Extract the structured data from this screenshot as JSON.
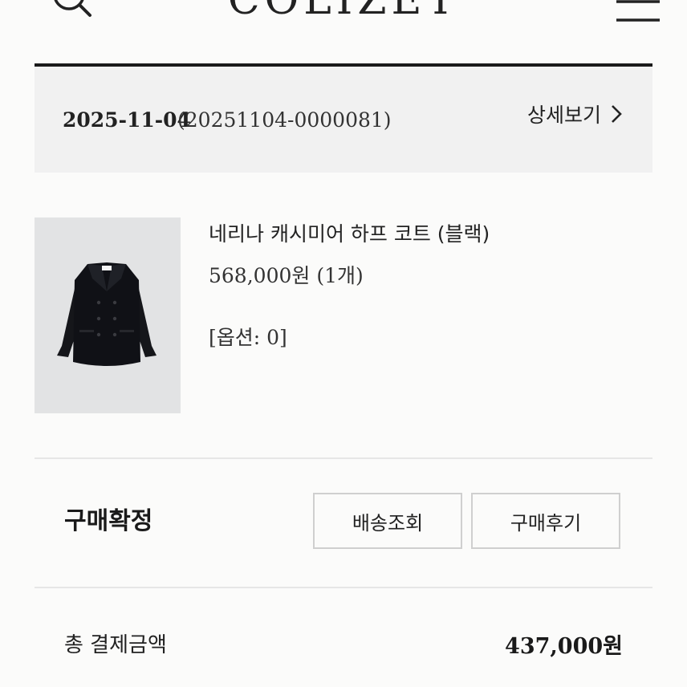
{
  "header": {
    "logo": "COLIZET",
    "search_icon": "search-icon",
    "menu_icon": "hamburger-menu-icon"
  },
  "order": {
    "date": "2025-11-04",
    "number": "(20251104-0000081)",
    "detail_label": "상세보기",
    "detail_icon": "chevron-right-icon"
  },
  "product": {
    "name": "네리나 캐시미어 하프 코트 (블랙)",
    "price": "568,000원 (1개)",
    "option": "[옵션: 0]",
    "image_icon": "coat-image"
  },
  "status": {
    "label": "구매확정",
    "track_button": "배송조회",
    "review_button": "구매후기"
  },
  "total": {
    "label": "총 결제금액",
    "value": "437,000원"
  },
  "colors": {
    "background": "#fbfbfa",
    "panel": "#f1f1f1",
    "text": "#1a1a1a",
    "border": "#cfcfcf"
  }
}
